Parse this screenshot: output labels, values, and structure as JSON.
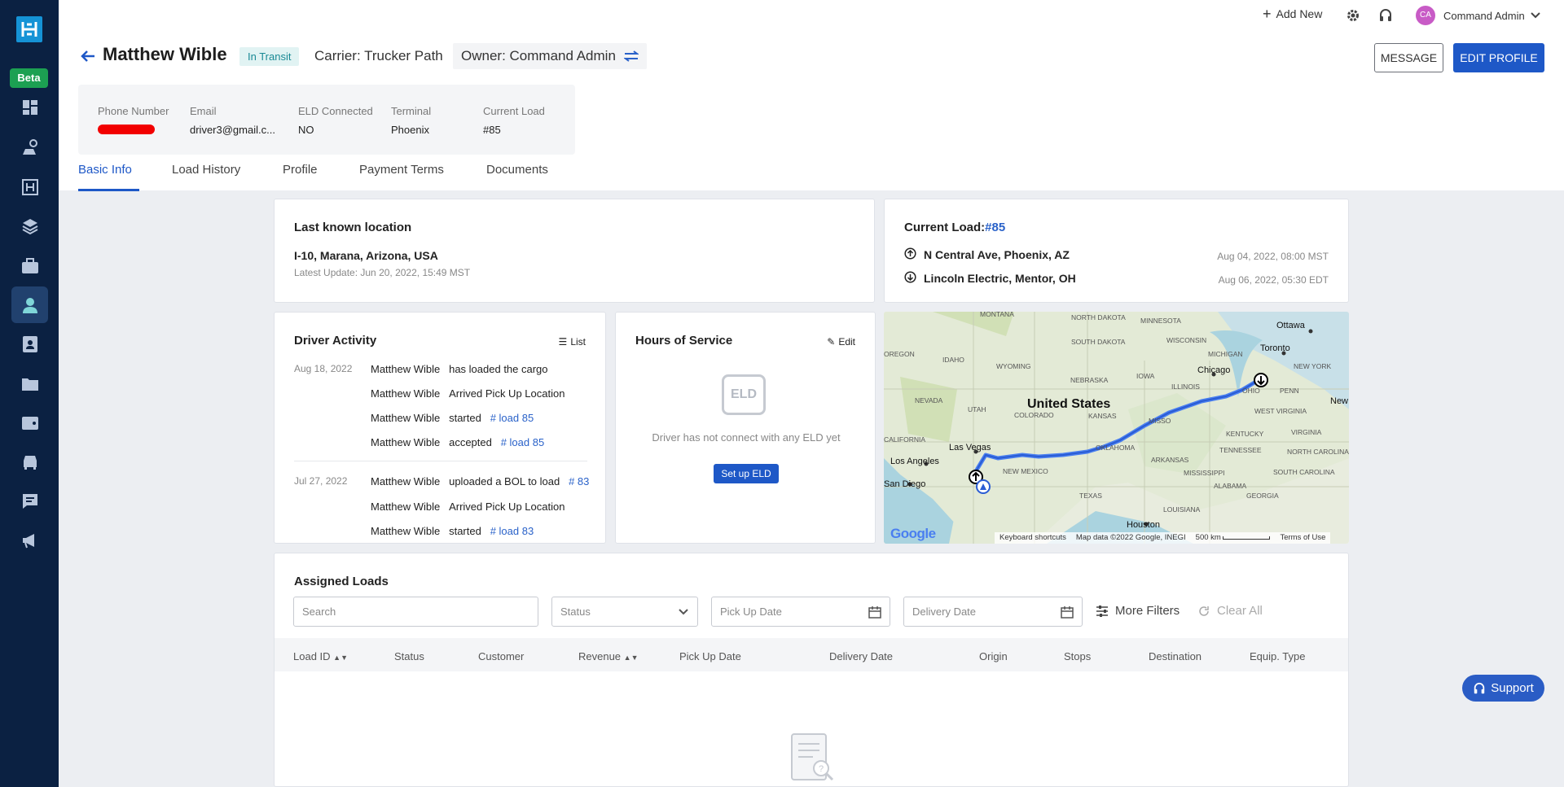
{
  "topbar": {
    "add_new": "Add New",
    "avatar_initials": "CA",
    "user_name": "Command Admin"
  },
  "sidebar": {
    "beta": "Beta",
    "items": [
      "dashboard",
      "dispatch",
      "loads-board",
      "layers",
      "briefcase",
      "drivers",
      "contacts",
      "folders",
      "wallet",
      "vehicles",
      "messages",
      "announcements"
    ]
  },
  "driver": {
    "name": "Matthew Wible",
    "status": "In Transit",
    "carrier": "Carrier: Trucker Path",
    "owner": "Owner: Command Admin"
  },
  "actions": {
    "message": "MESSAGE",
    "edit_profile": "EDIT PROFILE"
  },
  "info": {
    "phone_label": "Phone Number",
    "email_label": "Email",
    "email": "driver3@gmail.c...",
    "eld_label": "ELD Connected",
    "eld": "NO",
    "terminal_label": "Terminal",
    "terminal": "Phoenix",
    "current_load_label": "Current Load",
    "current_load": "#85"
  },
  "tabs": [
    "Basic Info",
    "Load History",
    "Profile",
    "Payment Terms",
    "Documents"
  ],
  "last_location": {
    "title": "Last known location",
    "address": "I-10, Marana, Arizona, USA",
    "updated": "Latest Update: Jun 20, 2022, 15:49 MST"
  },
  "current_load": {
    "title": "Current Load:",
    "id": "#85",
    "pickup": "N Central Ave, Phoenix, AZ",
    "pickup_time": "Aug 04, 2022, 08:00 MST",
    "delivery": "Lincoln Electric, Mentor, OH",
    "delivery_time": "Aug 06, 2022, 05:30 EDT"
  },
  "activity": {
    "title": "Driver Activity",
    "list": "List",
    "groups": [
      {
        "date": "Aug 18, 2022",
        "rows": [
          {
            "who": "Matthew Wible",
            "what": "has loaded the cargo",
            "link": ""
          },
          {
            "who": "Matthew Wible",
            "what": "Arrived Pick Up Location",
            "link": ""
          },
          {
            "who": "Matthew Wible",
            "what": "started",
            "link": "# load 85"
          },
          {
            "who": "Matthew Wible",
            "what": "accepted",
            "link": "# load 85"
          }
        ]
      },
      {
        "date": "Jul 27, 2022",
        "rows": [
          {
            "who": "Matthew Wible",
            "what": "uploaded a BOL to load",
            "link": "# 83"
          },
          {
            "who": "Matthew Wible",
            "what": "Arrived Pick Up Location",
            "link": ""
          },
          {
            "who": "Matthew Wible",
            "what": "started",
            "link": "# load 83"
          }
        ]
      }
    ]
  },
  "hos": {
    "title": "Hours of Service",
    "edit": "Edit",
    "eld_icon_text": "ELD",
    "message": "Driver has not connect with any ELD yet",
    "setup": "Set up ELD"
  },
  "map": {
    "labels": {
      "us": "United States",
      "chicago": "Chicago",
      "toronto": "Toronto",
      "ottawa": "Ottawa",
      "la": "Los Angeles",
      "lv": "Las Vegas",
      "sd": "San Diego",
      "houston": "Houston",
      "minnesota": "MINNESOTA",
      "wisconsin": "WISCONSIN",
      "michigan": "MICHIGAN",
      "iowa": "IOWA",
      "illinois": "ILLINOIS",
      "ohio": "OHIO",
      "nebraska": "NEBRASKA",
      "kansas": "KANSAS",
      "colorado": "COLORADO",
      "utah": "UTAH",
      "nevada": "NEVADA",
      "california": "CALIFORNIA",
      "wyoming": "WYOMING",
      "idaho": "IDAHO",
      "oregon": "OREGON",
      "montana": "MONTANA",
      "sd_state": "SOUTH DAKOTA",
      "nd_state": "NORTH DAKOTA",
      "new_mexico": "NEW MEXICO",
      "texas": "TEXAS",
      "oklahoma": "OKLAHOMA",
      "arkansas": "ARKANSAS",
      "mississippi": "MISSISSIPPI",
      "alabama": "ALABAMA",
      "georgia": "GEORGIA",
      "tennessee": "TENNESSEE",
      "kentucky": "KENTUCKY",
      "virginia": "VIRGINIA",
      "wv": "WEST VIRGINIA",
      "nc": "NORTH CAROLINA",
      "sc": "SOUTH CAROLINA",
      "louisiana": "LOUISIANA",
      "penn": "PENN",
      "new_york": "NEW YORK",
      "new": "New",
      "missouri": "MISSO"
    },
    "google": "Google",
    "keyboard": "Keyboard shortcuts",
    "map_data": "Map data ©2022 Google, INEGI",
    "scale": "500 km",
    "terms": "Terms of Use"
  },
  "assigned": {
    "title": "Assigned Loads",
    "search_placeholder": "Search",
    "status_placeholder": "Status",
    "pickup_placeholder": "Pick Up Date",
    "delivery_placeholder": "Delivery Date",
    "more_filters": "More Filters",
    "clear_all": "Clear All",
    "columns": [
      "Load ID",
      "Status",
      "Customer",
      "Revenue",
      "Pick Up Date",
      "Delivery Date",
      "Origin",
      "Stops",
      "Destination",
      "Equip. Type"
    ]
  },
  "support": "Support",
  "colors": {
    "sidebar": "#0b2142",
    "accent": "#1e58c7",
    "logo": "#1593d6",
    "beta": "#1ca052"
  }
}
